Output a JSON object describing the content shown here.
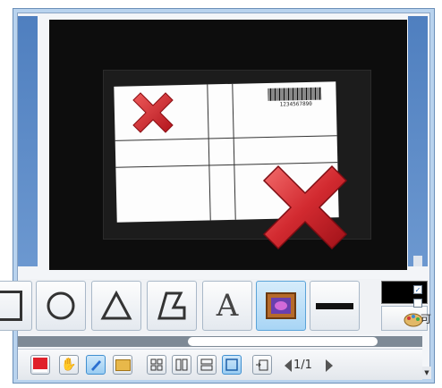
{
  "viewer": {
    "barcode_text": "1234567890"
  },
  "tools": [
    {
      "name": "rectangle",
      "icon": "rectangle-icon"
    },
    {
      "name": "ellipse",
      "icon": "ellipse-icon"
    },
    {
      "name": "triangle",
      "icon": "triangle-icon"
    },
    {
      "name": "polygon",
      "icon": "polygon-icon"
    },
    {
      "name": "text",
      "icon": "text-icon",
      "label": "A"
    },
    {
      "name": "image",
      "icon": "image-icon",
      "selected": true
    },
    {
      "name": "line",
      "icon": "line-icon"
    }
  ],
  "properties": {
    "color": "#000000",
    "side_label": "可"
  },
  "bottom_toolbar": {
    "page_indicator": "1/1"
  },
  "colors": {
    "frame": "#b9d3ee",
    "accent": "#5aa3d8",
    "mark_red": "#c9252b"
  }
}
